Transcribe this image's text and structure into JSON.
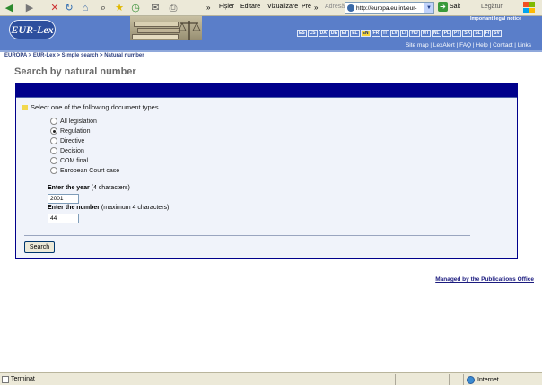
{
  "browser": {
    "menu": [
      "Fișier",
      "Editare",
      "Vizualizare",
      "Pre"
    ],
    "overflow_chevrons": "»",
    "address_label": "Adresă",
    "address_value": "http://europa.eu.int/eur-le",
    "go_label": "Salt",
    "links_label": "Legături",
    "status_text": "Terminat",
    "zone_label": "Internet"
  },
  "header": {
    "logo_text": "EUR-Lex",
    "legal_notice": "Important legal notice",
    "languages": [
      "ES",
      "CS",
      "DA",
      "DE",
      "ET",
      "EL",
      "EN",
      "FR",
      "IT",
      "LV",
      "LT",
      "HU",
      "MT",
      "NL",
      "PL",
      "PT",
      "SK",
      "SL",
      "FI",
      "SV"
    ],
    "active_language": "EN",
    "top_links": [
      "Site map",
      "LexAlert",
      "FAQ",
      "Help",
      "Contact",
      "Links"
    ],
    "top_links_separator": " | "
  },
  "breadcrumb": "EUROPA > EUR-Lex > Simple search > Natural number",
  "page_title": "Search by natural number",
  "form": {
    "section_label": "Select one of the following document types",
    "options": [
      {
        "label": "All legislation",
        "checked": false
      },
      {
        "label": "Regulation",
        "checked": true
      },
      {
        "label": "Directive",
        "checked": false
      },
      {
        "label": "Decision",
        "checked": false
      },
      {
        "label": "COM final",
        "checked": false
      },
      {
        "label": "European Court case",
        "checked": false
      }
    ],
    "year_label": "Enter the year",
    "year_hint": "(4 characters)",
    "year_value": "2001",
    "number_label": "Enter the number",
    "number_hint": "(maximum 4 characters)",
    "number_value": "44",
    "search_button": "Search"
  },
  "footer": {
    "managed_by": "Managed by the Publications Office"
  },
  "colors": {
    "header_blue": "#5a7ec9",
    "panel_navy": "#00008b",
    "lang_active": "#f4d23c"
  }
}
